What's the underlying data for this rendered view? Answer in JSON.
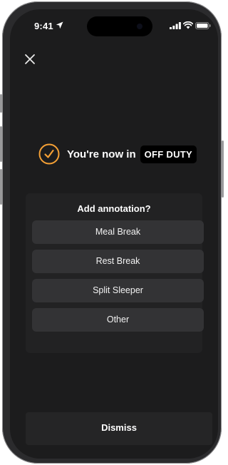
{
  "status_bar": {
    "time": "9:41"
  },
  "icons": {
    "close": "close-icon",
    "status_check": "check-circle-icon",
    "location": "location-arrow-icon",
    "signal": "cellular-signal-icon",
    "wifi": "wifi-icon",
    "battery": "battery-icon"
  },
  "status": {
    "message": "You're now in",
    "duty_state": "OFF DUTY"
  },
  "annotation": {
    "title": "Add annotation?",
    "options": [
      {
        "label": "Meal Break"
      },
      {
        "label": "Rest Break"
      },
      {
        "label": "Split Sleeper"
      },
      {
        "label": "Other"
      }
    ]
  },
  "footer": {
    "dismiss_label": "Dismiss"
  },
  "colors": {
    "accent": "#F5A035",
    "background": "#1C1C1D",
    "option_bg": "#333335",
    "badge_bg": "#000000"
  }
}
